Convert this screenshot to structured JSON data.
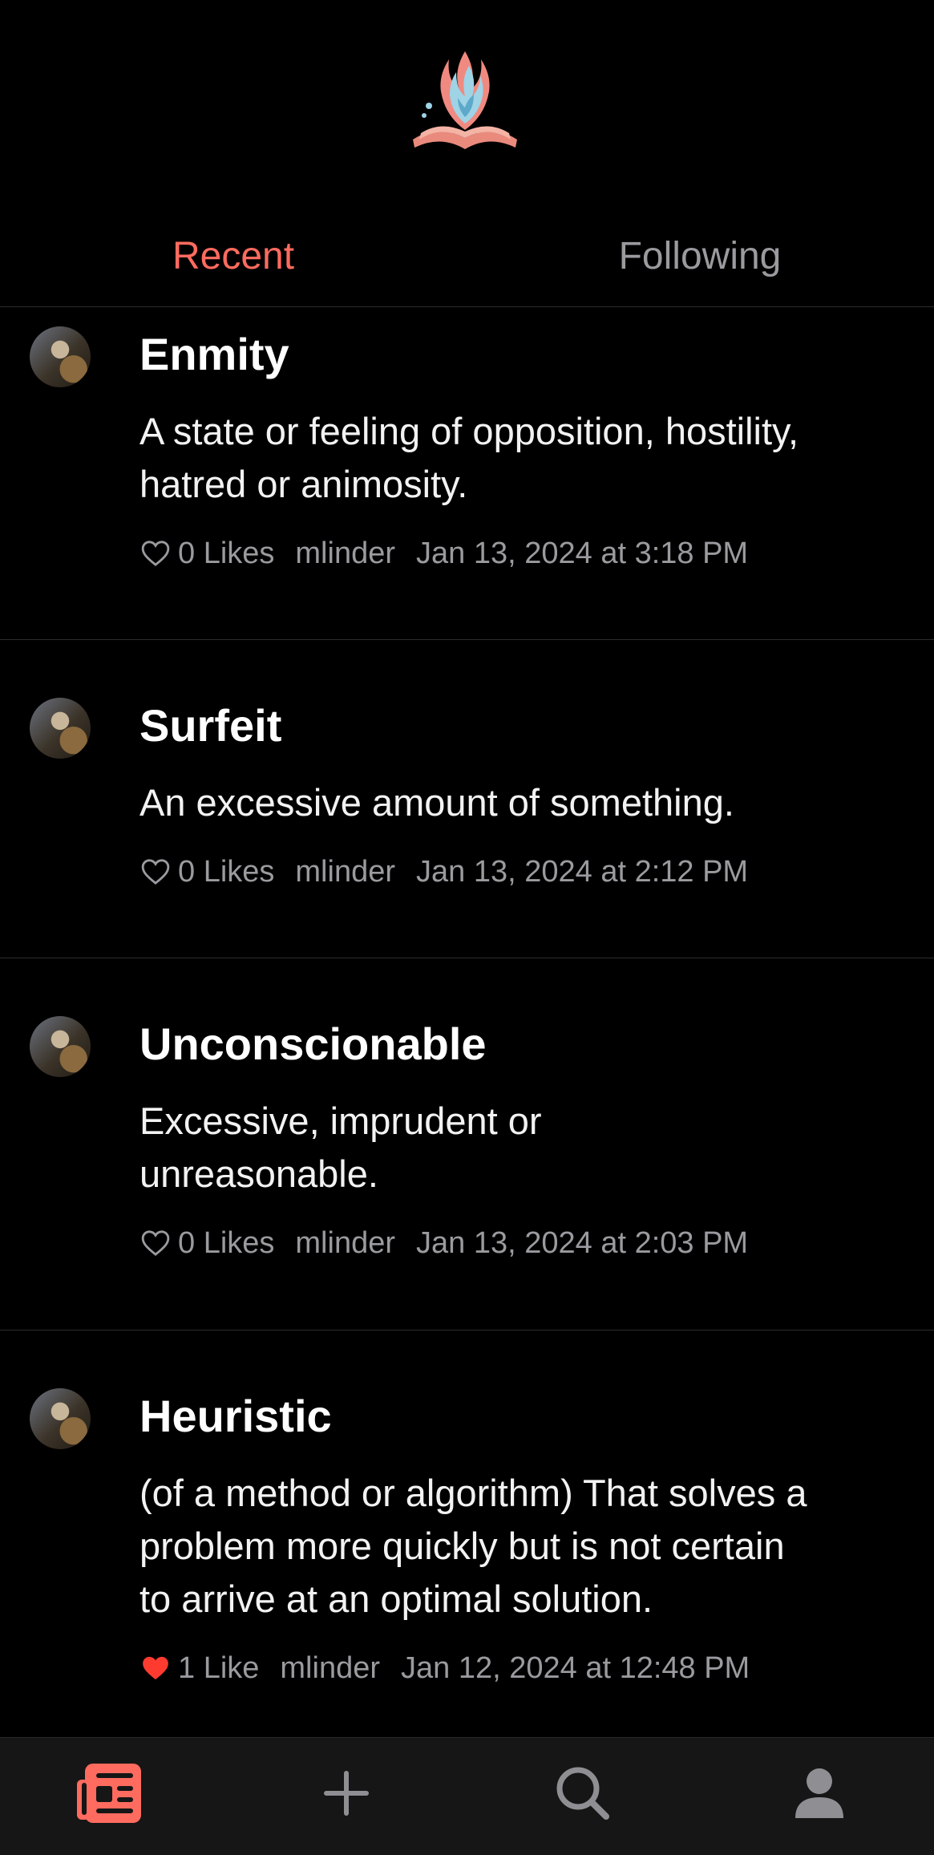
{
  "header": {
    "logo_icon": "book-flame-logo",
    "tabs": [
      {
        "label": "Recent",
        "active": true
      },
      {
        "label": "Following",
        "active": false
      }
    ]
  },
  "colors": {
    "accent": "#ff6b5f",
    "background": "#000000",
    "muted": "#9a9a9f",
    "liked_heart": "#ff3b30"
  },
  "posts": [
    {
      "title": "Enmity",
      "definition": "A state or feeling of opposition, hostility, hatred or animosity.",
      "likes": "0 Likes",
      "liked": false,
      "author": "mlinder",
      "timestamp": "Jan 13, 2024 at 3:18 PM"
    },
    {
      "title": "Surfeit",
      "definition": "An excessive amount of something.",
      "likes": "0 Likes",
      "liked": false,
      "author": "mlinder",
      "timestamp": "Jan 13, 2024 at 2:12 PM"
    },
    {
      "title": "Unconscionable",
      "definition": "Excessive, imprudent or unreasonable.",
      "likes": "0 Likes",
      "liked": false,
      "author": "mlinder",
      "timestamp": "Jan 13, 2024 at 2:03 PM"
    },
    {
      "title": "Heuristic",
      "definition": "(of a method or algorithm) That solves a problem more quickly but is not certain to arrive at an optimal solution.",
      "likes": "1 Like",
      "liked": true,
      "author": "mlinder",
      "timestamp": "Jan 12, 2024 at 12:48 PM"
    }
  ],
  "tabbar": {
    "items": [
      {
        "icon": "feed-icon",
        "active": true
      },
      {
        "icon": "plus-icon",
        "active": false
      },
      {
        "icon": "search-icon",
        "active": false
      },
      {
        "icon": "profile-icon",
        "active": false
      }
    ]
  }
}
